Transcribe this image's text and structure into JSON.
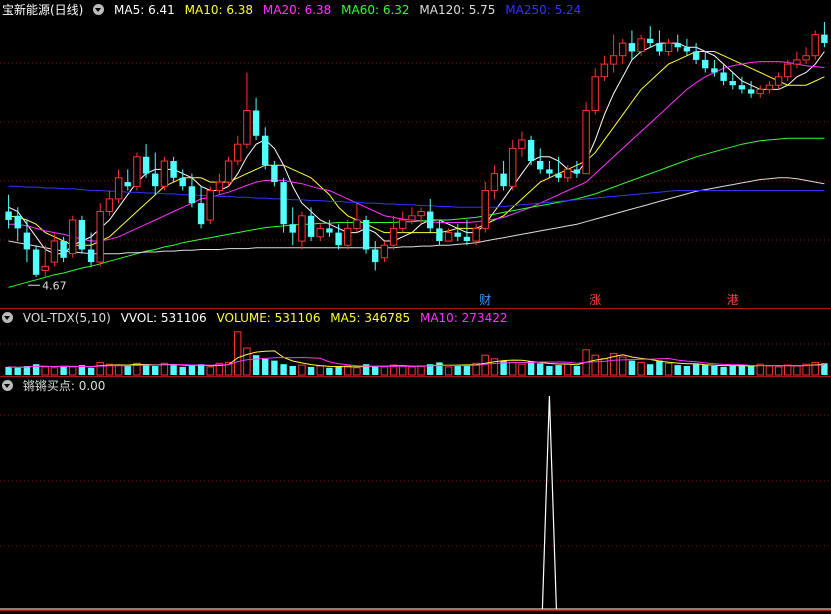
{
  "header": {
    "title": "宝新能源(日线)",
    "ma": [
      {
        "label": "MA5: 6.41",
        "color": "#ffffff"
      },
      {
        "label": "MA10: 6.38",
        "color": "#ffff33"
      },
      {
        "label": "MA20: 6.38",
        "color": "#ff33ff"
      },
      {
        "label": "MA60: 6.32",
        "color": "#33ff33"
      },
      {
        "label": "MA120: 5.75",
        "color": "#dddddd"
      },
      {
        "label": "MA250: 5.24",
        "color": "#3333ff"
      }
    ]
  },
  "price_panel": {
    "low_marker": "4.67",
    "events": [
      {
        "label": "财",
        "bar": 52,
        "color": "#3399ff"
      },
      {
        "label": "涨",
        "bar": 64,
        "color": "#ff4040"
      },
      {
        "label": "港",
        "bar": 79,
        "color": "#ff4040"
      }
    ]
  },
  "volume_panel": {
    "title": "VOL-TDX(5,10)",
    "items": [
      {
        "label": "VVOL: 531106",
        "color": "#ffffff"
      },
      {
        "label": "VOLUME: 531106",
        "color": "#ffff33"
      },
      {
        "label": "MA5: 346785",
        "color": "#ffff33"
      },
      {
        "label": "MA10: 273422",
        "color": "#ff33ff"
      }
    ]
  },
  "indicator_panel": {
    "title": "锵锵买点",
    "value": ": 0.00",
    "signal_bar": 59
  },
  "colors": {
    "up": "#ff3232",
    "down": "#54ffff",
    "grid": "#8a1010",
    "divider": "#b01818"
  },
  "chart_data": {
    "type": "candlestick",
    "price_range": [
      4.4,
      7.7
    ],
    "candles": [
      [
        5.45,
        5.65,
        5.35,
        5.25
      ],
      [
        5.4,
        5.5,
        5.25,
        5.1
      ],
      [
        5.2,
        5.35,
        5.0,
        4.85
      ],
      [
        5.0,
        5.05,
        4.7,
        4.67
      ],
      [
        4.75,
        5.05,
        4.8,
        4.68
      ],
      [
        4.85,
        5.2,
        5.1,
        4.8
      ],
      [
        5.1,
        5.15,
        4.9,
        4.85
      ],
      [
        4.95,
        5.4,
        5.35,
        4.9
      ],
      [
        5.35,
        5.4,
        5.0,
        4.95
      ],
      [
        5.0,
        5.2,
        4.85,
        4.8
      ],
      [
        4.85,
        5.55,
        5.45,
        4.8
      ],
      [
        5.45,
        5.7,
        5.6,
        5.4
      ],
      [
        5.6,
        5.95,
        5.85,
        5.55
      ],
      [
        5.8,
        5.95,
        5.75,
        5.7
      ],
      [
        5.75,
        6.15,
        6.1,
        5.7
      ],
      [
        6.1,
        6.25,
        5.9,
        5.85
      ],
      [
        5.9,
        6.15,
        5.75,
        5.65
      ],
      [
        5.75,
        6.1,
        6.05,
        5.7
      ],
      [
        6.05,
        6.1,
        5.85,
        5.8
      ],
      [
        5.85,
        5.95,
        5.75,
        5.7
      ],
      [
        5.75,
        5.9,
        5.55,
        5.5
      ],
      [
        5.55,
        5.75,
        5.3,
        5.25
      ],
      [
        5.35,
        5.75,
        5.7,
        5.3
      ],
      [
        5.7,
        5.9,
        5.8,
        5.65
      ],
      [
        5.8,
        6.1,
        6.05,
        5.75
      ],
      [
        6.05,
        6.35,
        6.25,
        6.0
      ],
      [
        6.25,
        7.1,
        6.65,
        6.2
      ],
      [
        6.65,
        6.8,
        6.35,
        6.3
      ],
      [
        6.35,
        6.45,
        6.0,
        5.95
      ],
      [
        6.0,
        6.05,
        5.8,
        5.75
      ],
      [
        5.8,
        5.85,
        5.3,
        5.2
      ],
      [
        5.3,
        5.5,
        5.2,
        5.05
      ],
      [
        5.1,
        5.45,
        5.4,
        5.0
      ],
      [
        5.4,
        5.5,
        5.15,
        5.1
      ],
      [
        5.15,
        5.3,
        5.25,
        5.1
      ],
      [
        5.25,
        5.35,
        5.2,
        5.15
      ],
      [
        5.2,
        5.3,
        5.05,
        5.0
      ],
      [
        5.05,
        5.35,
        5.25,
        5.0
      ],
      [
        5.25,
        5.55,
        5.35,
        5.2
      ],
      [
        5.35,
        5.4,
        5.0,
        4.95
      ],
      [
        5.0,
        5.1,
        4.85,
        4.75
      ],
      [
        4.9,
        5.1,
        5.05,
        4.85
      ],
      [
        5.05,
        5.4,
        5.25,
        5.0
      ],
      [
        5.25,
        5.45,
        5.35,
        5.2
      ],
      [
        5.35,
        5.5,
        5.4,
        5.3
      ],
      [
        5.4,
        5.5,
        5.45,
        5.3
      ],
      [
        5.45,
        5.6,
        5.25,
        5.2
      ],
      [
        5.25,
        5.35,
        5.1,
        5.05
      ],
      [
        5.1,
        5.25,
        5.2,
        5.1
      ],
      [
        5.2,
        5.3,
        5.15,
        5.1
      ],
      [
        5.15,
        5.35,
        5.1,
        5.05
      ],
      [
        5.1,
        5.3,
        5.25,
        5.05
      ],
      [
        5.25,
        5.8,
        5.7,
        5.2
      ],
      [
        5.7,
        6.0,
        5.9,
        5.6
      ],
      [
        5.9,
        6.05,
        5.75,
        5.7
      ],
      [
        5.75,
        6.3,
        6.2,
        5.7
      ],
      [
        6.2,
        6.4,
        6.3,
        6.1
      ],
      [
        6.3,
        6.35,
        6.05,
        6.0
      ],
      [
        6.05,
        6.2,
        5.95,
        5.9
      ],
      [
        5.95,
        6.05,
        5.9,
        5.85
      ],
      [
        5.9,
        6.1,
        5.85,
        5.8
      ],
      [
        5.85,
        6.0,
        5.95,
        5.8
      ],
      [
        5.95,
        6.05,
        5.9,
        5.85
      ],
      [
        5.9,
        6.75,
        6.65,
        5.9
      ],
      [
        6.65,
        7.15,
        7.05,
        6.6
      ],
      [
        7.05,
        7.3,
        7.2,
        7.0
      ],
      [
        7.2,
        7.55,
        7.3,
        7.1
      ],
      [
        7.3,
        7.5,
        7.45,
        7.2
      ],
      [
        7.45,
        7.6,
        7.35,
        7.25
      ],
      [
        7.35,
        7.55,
        7.5,
        7.3
      ],
      [
        7.5,
        7.65,
        7.45,
        7.4
      ],
      [
        7.45,
        7.6,
        7.35,
        7.3
      ],
      [
        7.35,
        7.5,
        7.45,
        7.3
      ],
      [
        7.45,
        7.55,
        7.4,
        7.35
      ],
      [
        7.4,
        7.5,
        7.35,
        7.3
      ],
      [
        7.35,
        7.45,
        7.25,
        7.2
      ],
      [
        7.25,
        7.35,
        7.15,
        7.1
      ],
      [
        7.15,
        7.25,
        7.1,
        7.05
      ],
      [
        7.1,
        7.2,
        7.0,
        6.95
      ],
      [
        7.0,
        7.1,
        6.95,
        6.9
      ],
      [
        6.95,
        7.05,
        6.9,
        6.85
      ],
      [
        6.9,
        7.0,
        6.85,
        6.8
      ],
      [
        6.85,
        6.95,
        6.9,
        6.8
      ],
      [
        6.9,
        7.0,
        6.95,
        6.85
      ],
      [
        6.95,
        7.1,
        7.05,
        6.9
      ],
      [
        7.05,
        7.25,
        7.2,
        7.0
      ],
      [
        7.2,
        7.35,
        7.25,
        7.15
      ],
      [
        7.25,
        7.4,
        7.3,
        7.2
      ],
      [
        7.3,
        7.6,
        7.55,
        7.25
      ],
      [
        7.55,
        7.7,
        7.45,
        7.4
      ]
    ],
    "volume": [
      9,
      8,
      10,
      12,
      9,
      8,
      10,
      9,
      11,
      8,
      14,
      12,
      11,
      10,
      13,
      12,
      10,
      13,
      11,
      9,
      10,
      12,
      9,
      13,
      14,
      48,
      30,
      22,
      18,
      16,
      12,
      10,
      11,
      9,
      10,
      8,
      9,
      10,
      8,
      12,
      10,
      9,
      11,
      10,
      9,
      10,
      12,
      14,
      9,
      10,
      11,
      13,
      22,
      18,
      16,
      14,
      12,
      15,
      13,
      10,
      11,
      12,
      10,
      28,
      22,
      18,
      24,
      20,
      16,
      14,
      12,
      16,
      13,
      11,
      10,
      12,
      11,
      10,
      9,
      10,
      11,
      10,
      12,
      10,
      9,
      11,
      10,
      12,
      14,
      13
    ],
    "ma_lines": {
      "MA5": [
        5.5,
        5.45,
        5.3,
        5.15,
        5.0,
        4.95,
        4.95,
        5.05,
        5.1,
        5.15,
        5.25,
        5.35,
        5.5,
        5.65,
        5.8,
        5.9,
        5.95,
        5.95,
        5.95,
        5.9,
        5.85,
        5.75,
        5.7,
        5.7,
        5.75,
        5.9,
        6.1,
        6.25,
        6.3,
        6.2,
        6.0,
        5.75,
        5.55,
        5.45,
        5.35,
        5.3,
        5.25,
        5.2,
        5.2,
        5.25,
        5.2,
        5.1,
        5.1,
        5.15,
        5.2,
        5.3,
        5.35,
        5.35,
        5.3,
        5.25,
        5.2,
        5.2,
        5.3,
        5.45,
        5.6,
        5.75,
        5.9,
        6.05,
        6.1,
        6.1,
        6.05,
        5.95,
        5.9,
        6.05,
        6.3,
        6.6,
        6.85,
        7.05,
        7.25,
        7.35,
        7.4,
        7.45,
        7.45,
        7.45,
        7.4,
        7.4,
        7.35,
        7.3,
        7.2,
        7.1,
        7.0,
        6.95,
        6.9,
        6.9,
        6.9,
        6.95,
        7.05,
        7.1,
        7.2,
        7.35
      ],
      "MA10": [
        5.4,
        5.38,
        5.35,
        5.3,
        5.2,
        5.15,
        5.1,
        5.05,
        5.05,
        5.05,
        5.1,
        5.15,
        5.25,
        5.35,
        5.45,
        5.55,
        5.65,
        5.75,
        5.8,
        5.85,
        5.85,
        5.85,
        5.8,
        5.8,
        5.8,
        5.85,
        5.9,
        5.95,
        6.0,
        6.0,
        6.0,
        5.95,
        5.9,
        5.85,
        5.75,
        5.65,
        5.5,
        5.4,
        5.35,
        5.3,
        5.25,
        5.2,
        5.2,
        5.2,
        5.2,
        5.2,
        5.2,
        5.2,
        5.22,
        5.25,
        5.25,
        5.25,
        5.3,
        5.35,
        5.4,
        5.5,
        5.6,
        5.7,
        5.8,
        5.85,
        5.9,
        5.95,
        6.0,
        6.05,
        6.15,
        6.3,
        6.45,
        6.6,
        6.75,
        6.9,
        7.0,
        7.1,
        7.2,
        7.25,
        7.3,
        7.35,
        7.35,
        7.35,
        7.3,
        7.25,
        7.2,
        7.15,
        7.1,
        7.05,
        7.0,
        6.95,
        6.95,
        6.95,
        7.0,
        7.05
      ],
      "MA20": [
        5.3,
        5.3,
        5.28,
        5.25,
        5.22,
        5.2,
        5.18,
        5.15,
        5.12,
        5.1,
        5.1,
        5.12,
        5.15,
        5.2,
        5.25,
        5.3,
        5.35,
        5.4,
        5.45,
        5.5,
        5.55,
        5.6,
        5.62,
        5.65,
        5.68,
        5.72,
        5.76,
        5.8,
        5.82,
        5.82,
        5.82,
        5.8,
        5.78,
        5.75,
        5.72,
        5.7,
        5.65,
        5.6,
        5.55,
        5.5,
        5.45,
        5.4,
        5.38,
        5.36,
        5.35,
        5.34,
        5.33,
        5.32,
        5.32,
        5.32,
        5.32,
        5.33,
        5.34,
        5.36,
        5.38,
        5.42,
        5.46,
        5.5,
        5.55,
        5.6,
        5.65,
        5.7,
        5.75,
        5.8,
        5.9,
        6.0,
        6.1,
        6.2,
        6.3,
        6.4,
        6.5,
        6.6,
        6.7,
        6.8,
        6.9,
        6.98,
        7.05,
        7.1,
        7.15,
        7.18,
        7.2,
        7.22,
        7.23,
        7.23,
        7.23,
        7.22,
        7.2,
        7.18,
        7.17,
        7.16
      ],
      "MA60": [
        4.55,
        4.58,
        4.61,
        4.64,
        4.67,
        4.7,
        4.72,
        4.75,
        4.78,
        4.8,
        4.83,
        4.86,
        4.89,
        4.92,
        4.95,
        4.98,
        5.0,
        5.03,
        5.05,
        5.08,
        5.1,
        5.12,
        5.14,
        5.16,
        5.18,
        5.2,
        5.22,
        5.24,
        5.26,
        5.27,
        5.28,
        5.29,
        5.3,
        5.3,
        5.31,
        5.31,
        5.32,
        5.32,
        5.32,
        5.32,
        5.32,
        5.32,
        5.32,
        5.33,
        5.33,
        5.34,
        5.34,
        5.35,
        5.35,
        5.36,
        5.37,
        5.38,
        5.4,
        5.42,
        5.44,
        5.46,
        5.48,
        5.5,
        5.52,
        5.54,
        5.56,
        5.58,
        5.6,
        5.63,
        5.66,
        5.7,
        5.74,
        5.78,
        5.82,
        5.86,
        5.9,
        5.94,
        5.98,
        6.02,
        6.06,
        6.1,
        6.13,
        6.16,
        6.19,
        6.22,
        6.25,
        6.27,
        6.29,
        6.3,
        6.31,
        6.32,
        6.32,
        6.32,
        6.32,
        6.32
      ],
      "MA120": [
        5.1,
        5.08,
        5.06,
        5.04,
        5.02,
        5.0,
        4.98,
        4.97,
        4.96,
        4.95,
        4.95,
        4.95,
        4.95,
        4.96,
        4.96,
        4.97,
        4.97,
        4.98,
        4.98,
        4.99,
        4.99,
        5.0,
        5.0,
        5.0,
        5.01,
        5.01,
        5.01,
        5.02,
        5.02,
        5.02,
        5.02,
        5.02,
        5.02,
        5.02,
        5.02,
        5.02,
        5.02,
        5.02,
        5.02,
        5.02,
        5.02,
        5.02,
        5.02,
        5.03,
        5.03,
        5.04,
        5.04,
        5.05,
        5.05,
        5.06,
        5.07,
        5.08,
        5.1,
        5.12,
        5.14,
        5.16,
        5.18,
        5.2,
        5.22,
        5.24,
        5.26,
        5.28,
        5.3,
        5.33,
        5.36,
        5.39,
        5.42,
        5.45,
        5.48,
        5.51,
        5.54,
        5.57,
        5.6,
        5.63,
        5.66,
        5.69,
        5.71,
        5.73,
        5.75,
        5.77,
        5.79,
        5.81,
        5.83,
        5.84,
        5.85,
        5.85,
        5.84,
        5.82,
        5.8,
        5.78
      ],
      "MA250": [
        5.75,
        5.75,
        5.74,
        5.74,
        5.73,
        5.73,
        5.72,
        5.72,
        5.71,
        5.7,
        5.7,
        5.69,
        5.69,
        5.68,
        5.68,
        5.67,
        5.67,
        5.66,
        5.66,
        5.65,
        5.65,
        5.64,
        5.64,
        5.63,
        5.63,
        5.62,
        5.62,
        5.61,
        5.61,
        5.6,
        5.6,
        5.59,
        5.59,
        5.58,
        5.58,
        5.57,
        5.57,
        5.56,
        5.56,
        5.55,
        5.55,
        5.54,
        5.54,
        5.53,
        5.53,
        5.52,
        5.52,
        5.51,
        5.51,
        5.5,
        5.5,
        5.5,
        5.5,
        5.5,
        5.51,
        5.52,
        5.53,
        5.54,
        5.55,
        5.56,
        5.57,
        5.58,
        5.59,
        5.6,
        5.61,
        5.62,
        5.63,
        5.64,
        5.65,
        5.66,
        5.67,
        5.68,
        5.69,
        5.7,
        5.7,
        5.7,
        5.7,
        5.7,
        5.7,
        5.7,
        5.7,
        5.7,
        5.7,
        5.7,
        5.7,
        5.7,
        5.7,
        5.7,
        5.7,
        5.7
      ]
    }
  }
}
